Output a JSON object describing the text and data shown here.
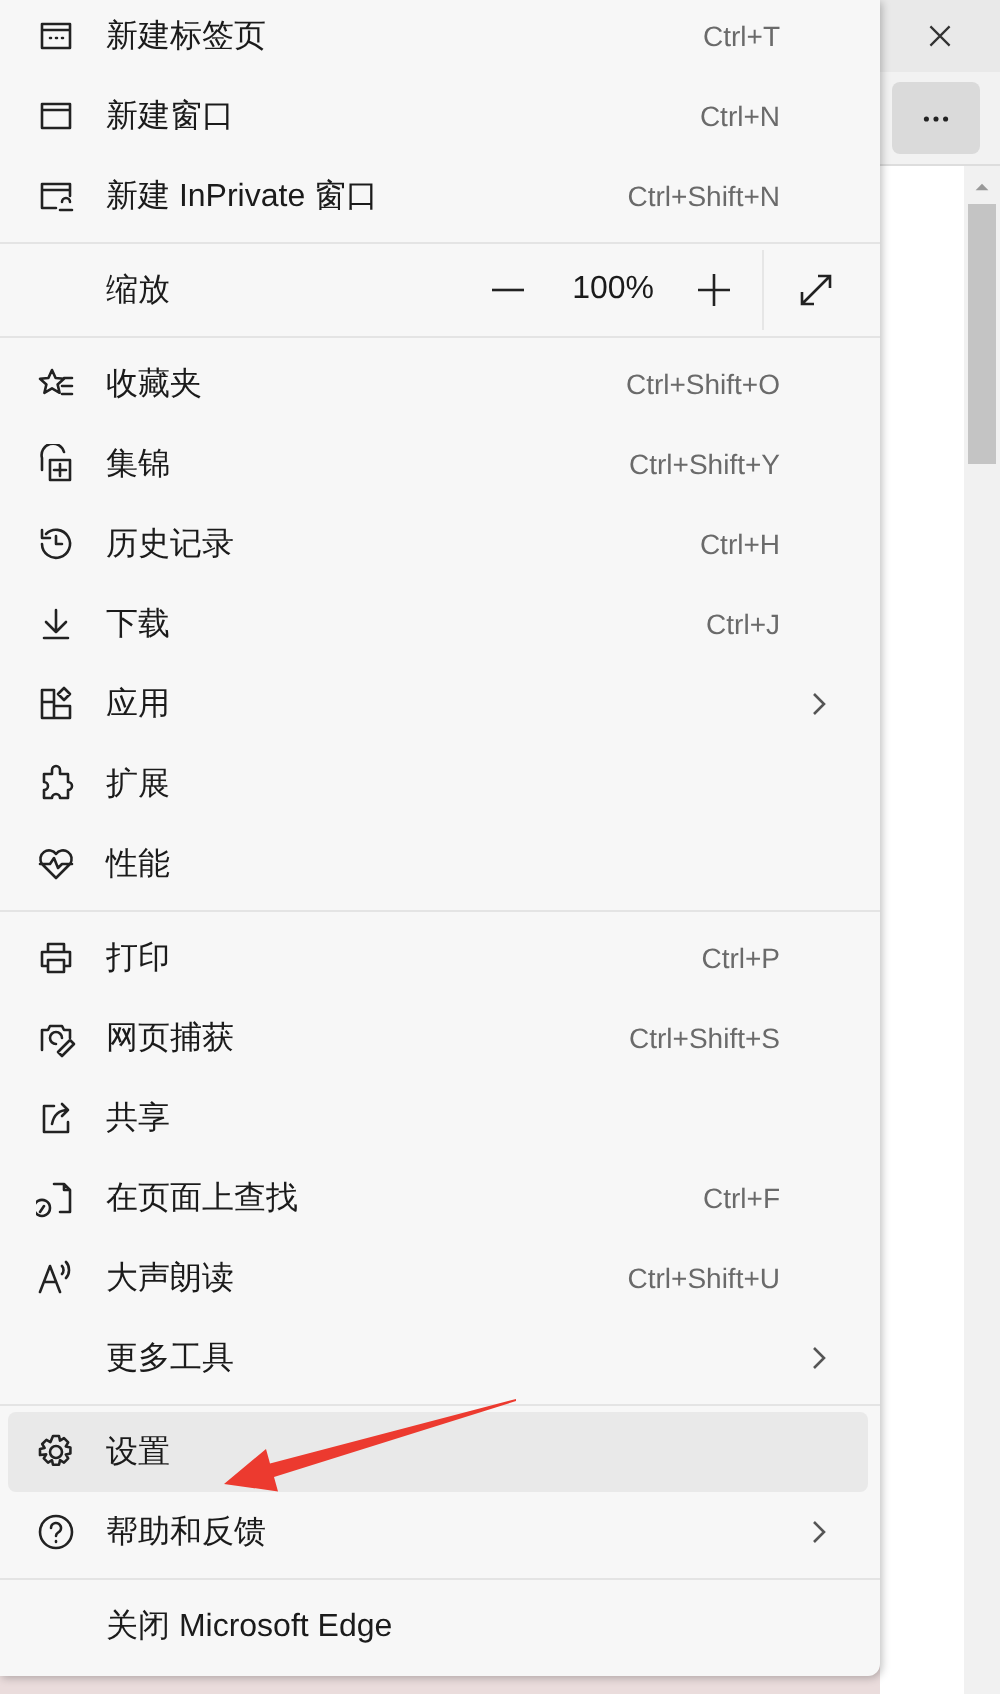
{
  "menu": {
    "groups": [
      {
        "items": [
          {
            "kind": "item",
            "label": "新建标签页",
            "shortcut": "Ctrl+T",
            "submenu": false,
            "selected": false
          },
          {
            "kind": "item",
            "label": "新建窗口",
            "shortcut": "Ctrl+N",
            "submenu": false,
            "selected": false
          },
          {
            "kind": "item",
            "label": "新建 InPrivate 窗口",
            "shortcut": "Ctrl+Shift+N",
            "submenu": false,
            "selected": false
          }
        ]
      },
      {
        "items": [
          {
            "kind": "zoom",
            "label": "缩放",
            "value": "100%"
          }
        ]
      },
      {
        "items": [
          {
            "kind": "item",
            "label": "收藏夹",
            "shortcut": "Ctrl+Shift+O",
            "submenu": false,
            "selected": false
          },
          {
            "kind": "item",
            "label": "集锦",
            "shortcut": "Ctrl+Shift+Y",
            "submenu": false,
            "selected": false
          },
          {
            "kind": "item",
            "label": "历史记录",
            "shortcut": "Ctrl+H",
            "submenu": false,
            "selected": false
          },
          {
            "kind": "item",
            "label": "下载",
            "shortcut": "Ctrl+J",
            "submenu": false,
            "selected": false
          },
          {
            "kind": "item",
            "label": "应用",
            "submenu": true,
            "selected": false
          },
          {
            "kind": "item",
            "label": "扩展",
            "submenu": false,
            "selected": false
          },
          {
            "kind": "item",
            "label": "性能",
            "submenu": false,
            "selected": false
          }
        ]
      },
      {
        "items": [
          {
            "kind": "item",
            "label": "打印",
            "shortcut": "Ctrl+P",
            "submenu": false,
            "selected": false
          },
          {
            "kind": "item",
            "label": "网页捕获",
            "shortcut": "Ctrl+Shift+S",
            "submenu": false,
            "selected": false
          },
          {
            "kind": "item",
            "label": "共享",
            "submenu": false,
            "selected": false
          },
          {
            "kind": "item",
            "label": "在页面上查找",
            "shortcut": "Ctrl+F",
            "submenu": false,
            "selected": false
          },
          {
            "kind": "item",
            "label": "大声朗读",
            "shortcut": "Ctrl+Shift+U",
            "submenu": false,
            "selected": false
          },
          {
            "kind": "item",
            "label": "更多工具",
            "submenu": true,
            "selected": false
          }
        ]
      },
      {
        "items": [
          {
            "kind": "item",
            "label": "设置",
            "submenu": false,
            "selected": true
          },
          {
            "kind": "item",
            "label": "帮助和反馈",
            "submenu": true,
            "selected": false
          }
        ]
      },
      {
        "items": [
          {
            "kind": "item",
            "label": "关闭 Microsoft Edge",
            "submenu": false,
            "selected": false
          }
        ]
      }
    ]
  }
}
